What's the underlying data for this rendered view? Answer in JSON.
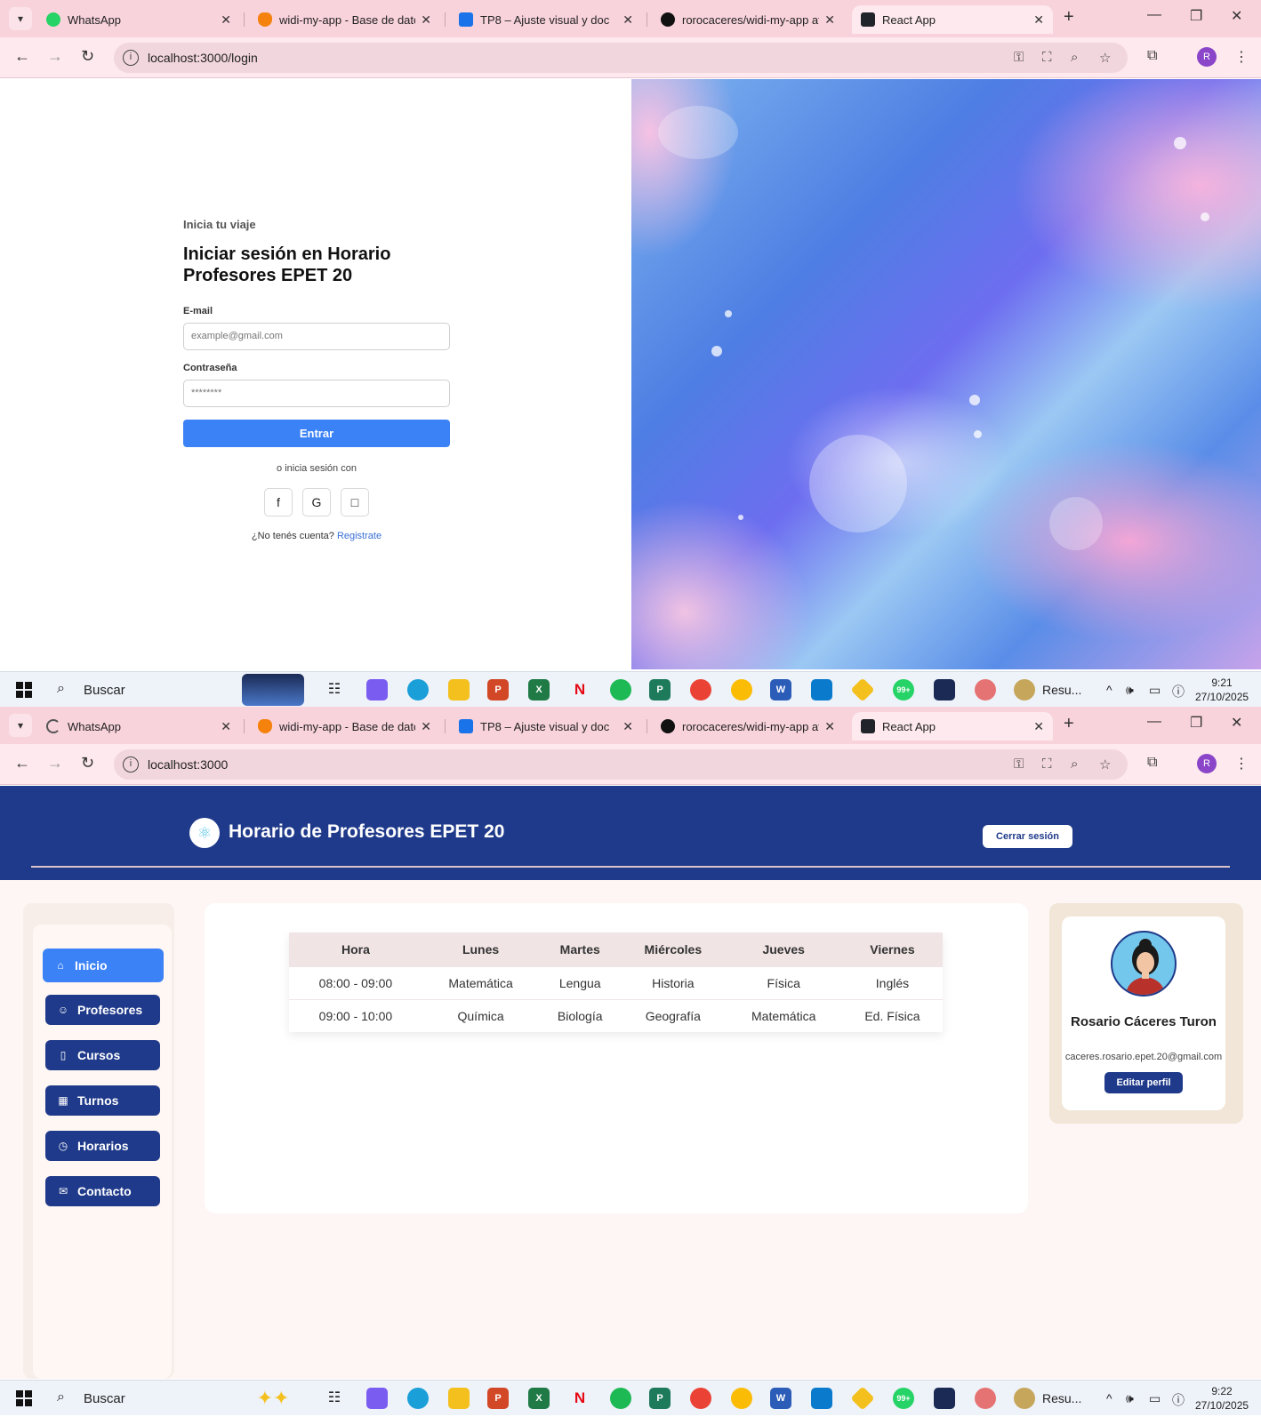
{
  "browser": {
    "tabs": [
      {
        "label": "WhatsApp"
      },
      {
        "label": "widi-my-app - Base de dato"
      },
      {
        "label": "TP8 – Ajuste visual y doc"
      },
      {
        "label": "rorocaceres/widi-my-app at"
      },
      {
        "label": "React App"
      }
    ],
    "url_login": "localhost:3000/login",
    "url_home": "localhost:3000",
    "profile_initial": "R"
  },
  "taskbar": {
    "search_placeholder": "Buscar",
    "active_app_label": "Resu...",
    "date": "27/10/2025",
    "time_first": "9:21",
    "time_second": "9:22",
    "whatsapp_badge": "99+"
  },
  "login": {
    "kicker": "Inicia tu viaje",
    "title": "Iniciar sesión en Horario Profesores EPET 20",
    "email_label": "E-mail",
    "email_placeholder": "example@gmail.com",
    "password_label": "Contraseña",
    "password_value": "********",
    "submit_label": "Entrar",
    "alt_text": "o inicia sesión con",
    "social": [
      "f",
      "G",
      "□"
    ],
    "no_account": "¿No tenés cuenta?",
    "register_link": "Registrate"
  },
  "app": {
    "title": "Horario de Profesores EPET 20",
    "logout_label": "Cerrar sesión",
    "nav": [
      {
        "label": "Inicio",
        "icon": "home-icon"
      },
      {
        "label": "Profesores",
        "icon": "users-icon"
      },
      {
        "label": "Cursos",
        "icon": "book-icon"
      },
      {
        "label": "Turnos",
        "icon": "calendar-icon"
      },
      {
        "label": "Horarios",
        "icon": "clock-icon"
      },
      {
        "label": "Contacto",
        "icon": "mail-icon"
      }
    ],
    "schedule": {
      "headers": [
        "Hora",
        "Lunes",
        "Martes",
        "Miércoles",
        "Jueves",
        "Viernes"
      ],
      "rows": [
        [
          "08:00 - 09:00",
          "Matemática",
          "Lengua",
          "Historia",
          "Física",
          "Inglés"
        ],
        [
          "09:00 - 10:00",
          "Química",
          "Biología",
          "Geografía",
          "Matemática",
          "Ed. Física"
        ]
      ]
    },
    "profile": {
      "name": "Rosario Cáceres Turon",
      "email": "caceres.rosario.epet.20@gmail.com",
      "edit_label": "Editar perfil"
    }
  },
  "colors": {
    "tabstrip": "#f9d3dc",
    "header_blue": "#1f3a8a",
    "active_nav": "#3b82f6",
    "login_button": "#3b82f6"
  }
}
